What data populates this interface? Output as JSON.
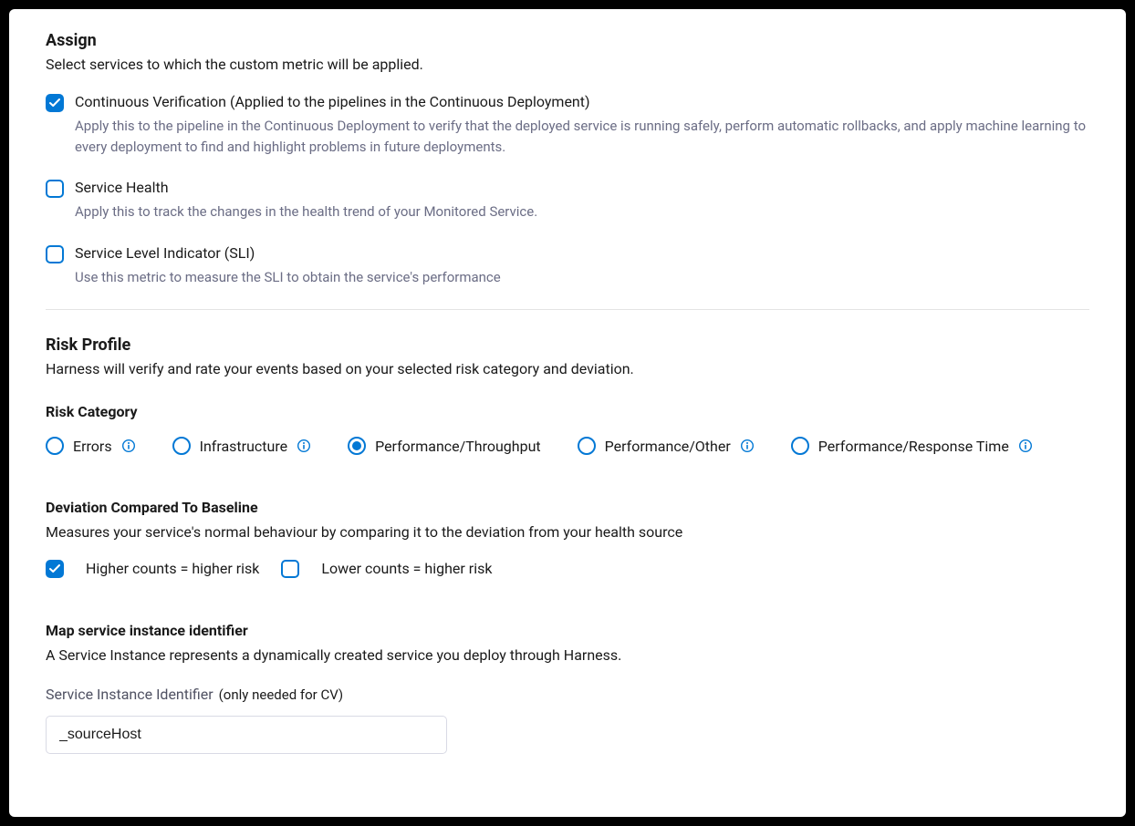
{
  "assign": {
    "title": "Assign",
    "subtitle": "Select services to which the custom metric will be applied.",
    "options": [
      {
        "label": "Continuous Verification (Applied to the pipelines in the Continuous Deployment)",
        "desc": "Apply this to the pipeline in the Continuous Deployment to verify that the deployed service is running safely, perform automatic rollbacks, and apply machine learning to every deployment to find and highlight problems in future deployments.",
        "checked": true
      },
      {
        "label": "Service Health",
        "desc": "Apply this to track the changes in the health trend of your Monitored Service.",
        "checked": false
      },
      {
        "label": "Service Level Indicator (SLI)",
        "desc": "Use this metric to measure the SLI to obtain the service's performance",
        "checked": false
      }
    ]
  },
  "risk_profile": {
    "title": "Risk Profile",
    "subtitle": "Harness will verify and rate your events based on your selected risk category and deviation.",
    "category_heading": "Risk Category",
    "categories": [
      {
        "label": "Errors",
        "selected": false
      },
      {
        "label": "Infrastructure",
        "selected": false
      },
      {
        "label": "Performance/Throughput",
        "selected": true
      },
      {
        "label": "Performance/Other",
        "selected": false
      },
      {
        "label": "Performance/Response Time",
        "selected": false
      }
    ],
    "deviation_heading": "Deviation Compared To Baseline",
    "deviation_desc": "Measures your service's normal behaviour by comparing it to the deviation from your health source",
    "deviation_options": [
      {
        "label": "Higher counts = higher risk",
        "checked": true
      },
      {
        "label": "Lower counts = higher risk",
        "checked": false
      }
    ]
  },
  "map_instance": {
    "title": "Map service instance identifier",
    "subtitle": "A Service Instance represents a dynamically created service you deploy through Harness.",
    "field_label": "Service Instance Identifier",
    "field_hint": "(only needed for CV)",
    "field_value": "_sourceHost"
  }
}
